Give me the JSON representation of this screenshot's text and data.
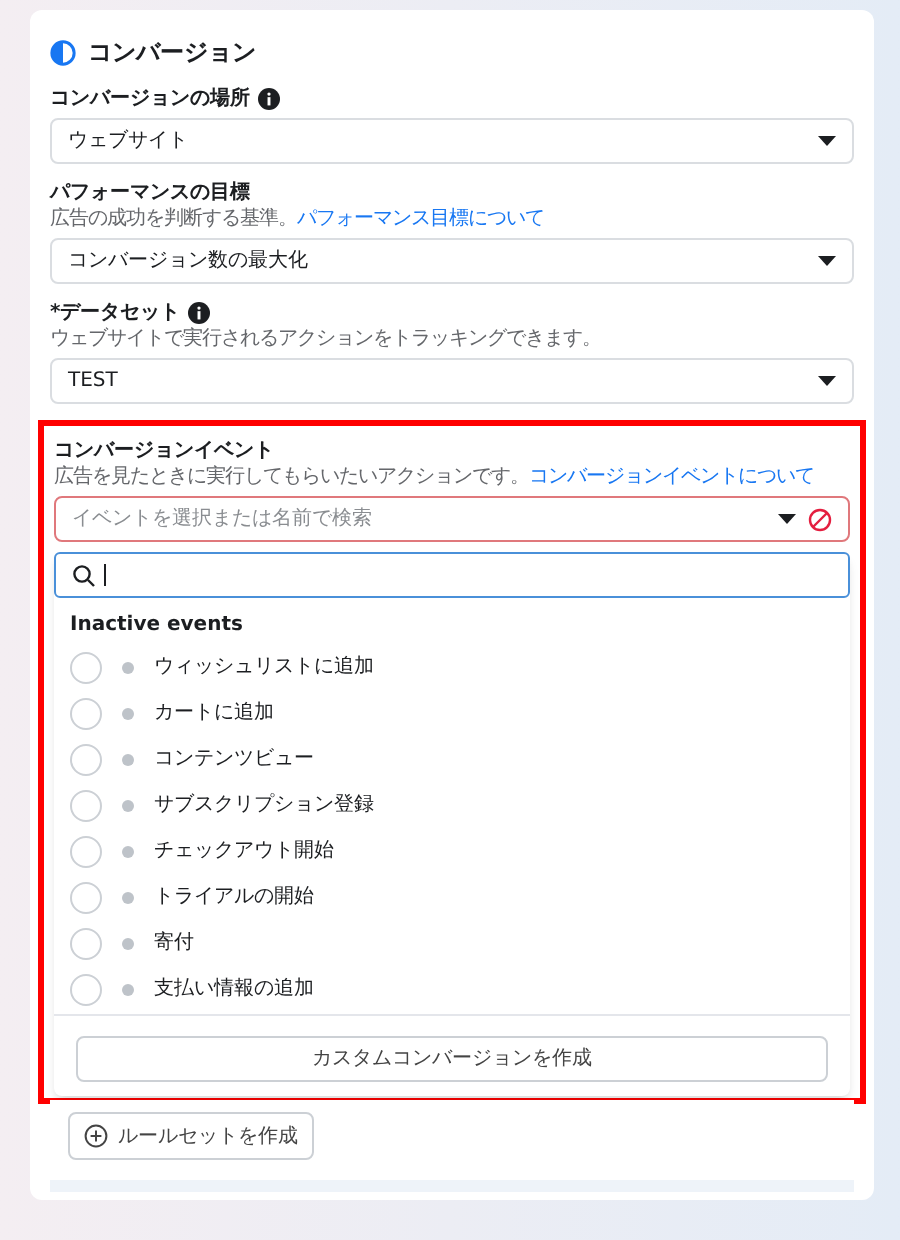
{
  "section": {
    "title": "コンバージョン"
  },
  "fields": [
    {
      "label": "コンバージョンの場所",
      "info": true,
      "value": "ウェブサイト"
    },
    {
      "label": "パフォーマンスの目標",
      "info": false,
      "hint": "広告の成功を判断する基準。",
      "hint_link": "パフォーマンス目標について",
      "value": "コンバージョン数の最大化"
    },
    {
      "label": "*データセット",
      "info": true,
      "hint": "ウェブサイトで実行されるアクションをトラッキングできます。",
      "value": "TEST"
    }
  ],
  "event_field": {
    "label": "コンバージョンイベント",
    "hint": "広告を見たときに実行してもらいたいアクションです。",
    "hint_link": "コンバージョンイベントについて",
    "placeholder": "イベントを選択または名前で検索",
    "error": true
  },
  "dropdown": {
    "group": "Inactive events",
    "items": [
      {
        "label": "ウィッシュリストに追加",
        "selected": false
      },
      {
        "label": "カートに追加",
        "selected": false
      },
      {
        "label": "コンテンツビュー",
        "selected": false
      },
      {
        "label": "サブスクリプション登録",
        "selected": false
      },
      {
        "label": "チェックアウト開始",
        "selected": false
      },
      {
        "label": "トライアルの開始",
        "selected": false
      },
      {
        "label": "寄付",
        "selected": false
      },
      {
        "label": "支払い情報の追加",
        "selected": false
      }
    ],
    "footer_button": "カスタムコンバージョンを作成"
  },
  "ruleset_button": "ルールセットを作成"
}
